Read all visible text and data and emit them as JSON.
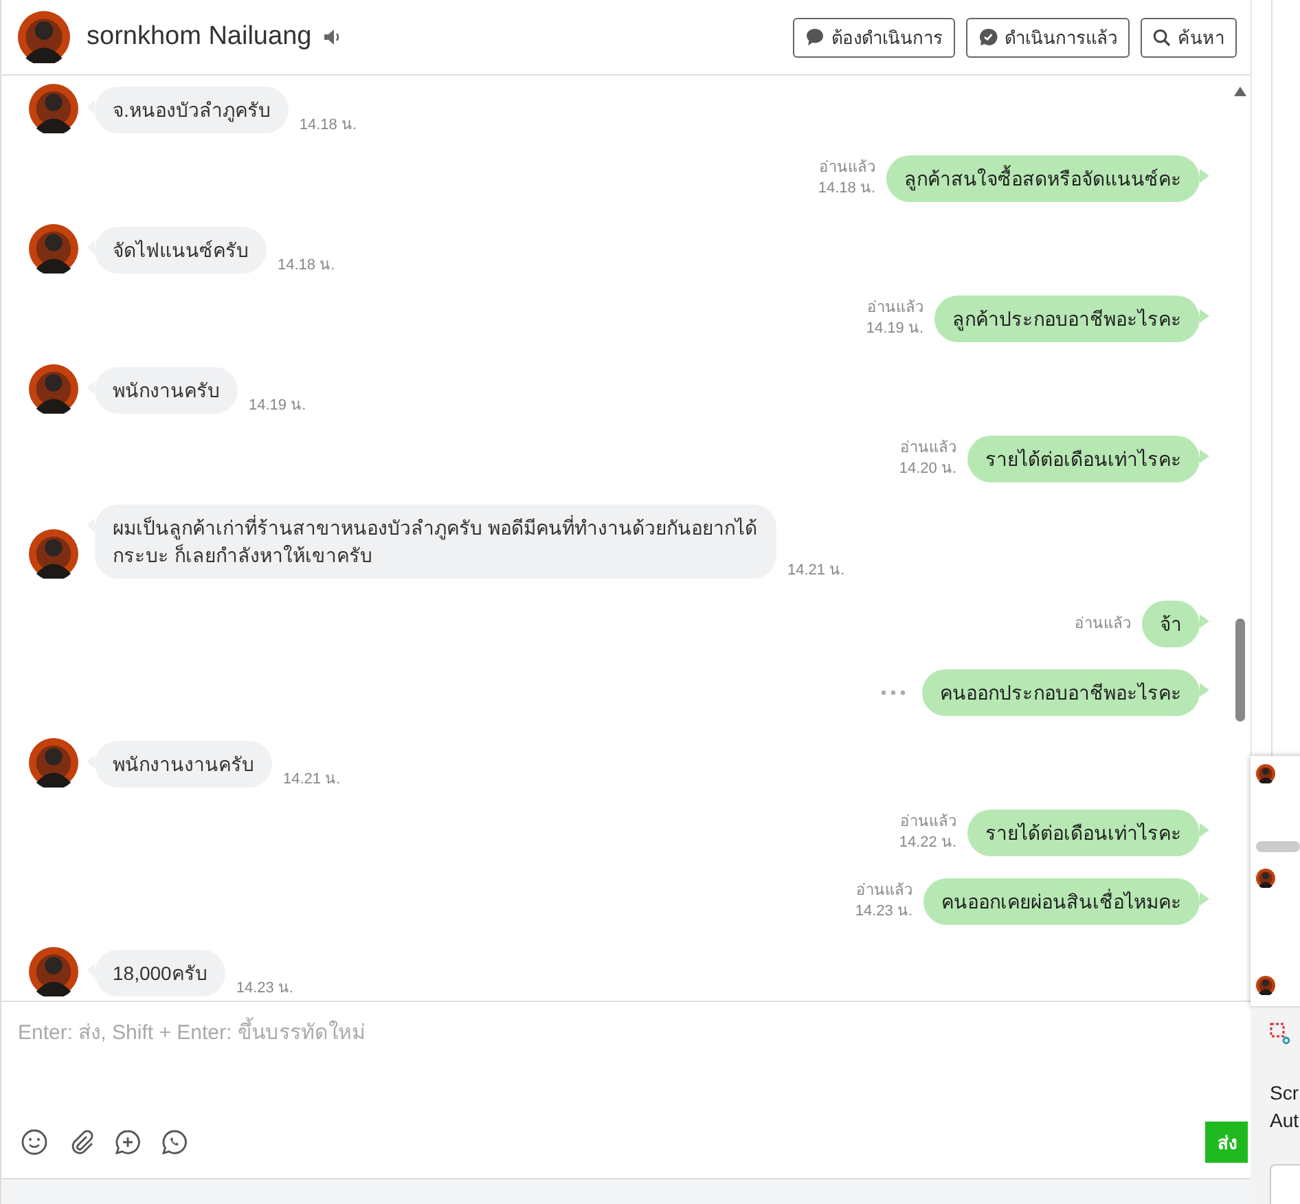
{
  "header": {
    "name": "sornkhom Nailuang",
    "buttons": [
      {
        "label": "ต้องดำเนินการ"
      },
      {
        "label": "ดำเนินการแล้ว"
      },
      {
        "label": "ค้นหา"
      }
    ]
  },
  "messages": [
    {
      "kind": "incoming",
      "text": "จ.หนองบัวลำภูครับ",
      "time": "14.18 น.",
      "menu_shown": false
    },
    {
      "kind": "outgoing",
      "text": "ลูกค้าสนใจซื้อสดหรือจัดแนนซ์คะ",
      "read": "อ่านแล้ว",
      "time": "14.18 น.",
      "menu_shown": false
    },
    {
      "kind": "incoming",
      "text": "จัดไฟแนนซ์ครับ",
      "time": "14.18 น.",
      "menu_shown": false
    },
    {
      "kind": "outgoing",
      "text": "ลูกค้าประกอบอาชีพอะไรคะ",
      "read": "อ่านแล้ว",
      "time": "14.19 น.",
      "menu_shown": false
    },
    {
      "kind": "incoming",
      "text": "พนักงานครับ",
      "time": "14.19 น.",
      "menu_shown": false
    },
    {
      "kind": "outgoing",
      "text": "รายได้ต่อเดือนเท่าไรคะ",
      "read": "อ่านแล้ว",
      "time": "14.20 น.",
      "menu_shown": false
    },
    {
      "kind": "incoming",
      "text": "ผมเป็นลูกค้าเก่าที่ร้านสาขาหนองบัวลำภูครับ พอดีมีคนที่ทำงานด้วยกันอยากได้กระบะ ก็เลยกำลังหาให้เขาครับ",
      "time": "14.21 น.",
      "menu_shown": false
    },
    {
      "kind": "outgoing",
      "text": "จ้า",
      "read": "อ่านแล้ว",
      "menu_shown": false
    },
    {
      "kind": "outgoing",
      "text": "คนออกประกอบอาชีพอะไรคะ",
      "menu_shown": true
    },
    {
      "kind": "incoming",
      "text": "พนักงานงานครับ",
      "time": "14.21 น.",
      "menu_shown": false
    },
    {
      "kind": "outgoing",
      "text": "รายได้ต่อเดือนเท่าไรคะ",
      "read": "อ่านแล้ว",
      "time": "14.22 น.",
      "menu_shown": false
    },
    {
      "kind": "outgoing",
      "text": "คนออกเคยผ่อนสินเชื่อไหมคะ",
      "read": "อ่านแล้ว",
      "time": "14.23 น.",
      "menu_shown": false
    },
    {
      "kind": "incoming",
      "text": "18,000ครับ",
      "time": "14.23 น.",
      "menu_shown": false
    }
  ],
  "composer": {
    "placeholder": "Enter: ส่ง, Shift + Enter: ขึ้นบรรทัดใหม่",
    "send_label": "ส่ง"
  },
  "notification": {
    "title": "Scr",
    "subtitle": "Aut"
  }
}
